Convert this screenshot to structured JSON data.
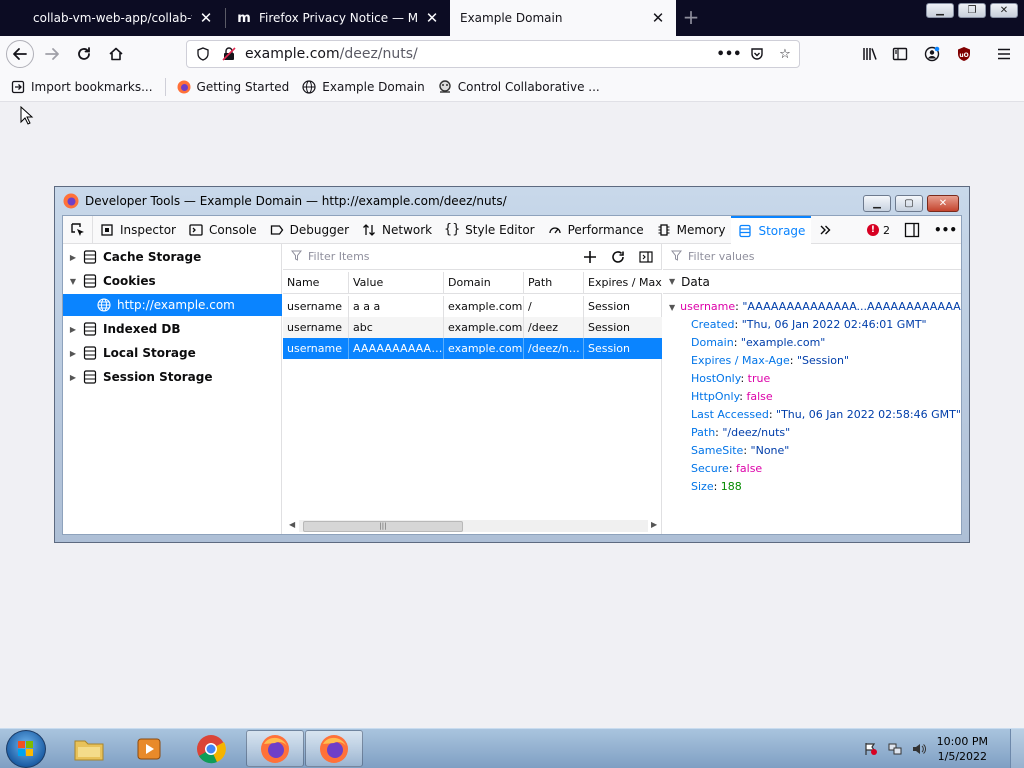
{
  "tabs": [
    {
      "title": "collab-vm-web-app/collab-vm",
      "favicon": "github-icon",
      "selected": false
    },
    {
      "title": "Firefox Privacy Notice — Mozilla",
      "favicon": "mozilla-icon",
      "selected": false
    },
    {
      "title": "Example Domain",
      "favicon": "",
      "selected": true
    }
  ],
  "tab_close_glyph": "✕",
  "newtab_glyph": "+",
  "urlbar": {
    "host": "example.com",
    "path": "/deez/nuts/"
  },
  "bookmarks": [
    {
      "label": "Import bookmarks...",
      "icon": "import-icon"
    },
    {
      "label": "Getting Started",
      "icon": "firefox-icon"
    },
    {
      "label": "Example Domain",
      "icon": "globe-icon"
    },
    {
      "label": "Control Collaborative ...",
      "icon": "collab-icon"
    }
  ],
  "devtools": {
    "title": "Developer Tools — Example Domain — http://example.com/deez/nuts/",
    "tools": [
      "Inspector",
      "Console",
      "Debugger",
      "Network",
      "Style Editor",
      "Performance",
      "Memory",
      "Storage"
    ],
    "selected_tool": "Storage",
    "error_count": "2",
    "tree": {
      "cache": "Cache Storage",
      "cookies": "Cookies",
      "cookie_host": "http://example.com",
      "indexeddb": "Indexed DB",
      "local": "Local Storage",
      "session": "Session Storage"
    },
    "filter_items_placeholder": "Filter Items",
    "filter_values_placeholder": "Filter values",
    "columns": [
      "Name",
      "Value",
      "Domain",
      "Path",
      "Expires / Max-Age"
    ],
    "rows": [
      [
        "username",
        "a a a",
        "example.com",
        "/",
        "Session"
      ],
      [
        "username",
        "abc",
        "example.com",
        "/deez",
        "Session"
      ],
      [
        "username",
        "AAAAAAAAAAAAAAAAAAAAAAAAAAAAAA",
        "example.com",
        "/deez/nuts",
        "Session"
      ]
    ],
    "selected_row": 2,
    "data_header": "Data",
    "data_root": {
      "key": "username",
      "value": "\"AAAAAAAAAAAAAA...AAAAAAAAAAAAAA\""
    },
    "data_props": [
      {
        "key": "Created",
        "value": "\"Thu, 06 Jan 2022 02:46:01 GMT\"",
        "kind": "str"
      },
      {
        "key": "Domain",
        "value": "\"example.com\"",
        "kind": "str"
      },
      {
        "key": "Expires / Max-Age",
        "value": "\"Session\"",
        "kind": "str"
      },
      {
        "key": "HostOnly",
        "value": "true",
        "kind": "bool"
      },
      {
        "key": "HttpOnly",
        "value": "false",
        "kind": "bool"
      },
      {
        "key": "Last Accessed",
        "value": "\"Thu, 06 Jan 2022 02:58:46 GMT\"",
        "kind": "str"
      },
      {
        "key": "Path",
        "value": "\"/deez/nuts\"",
        "kind": "str"
      },
      {
        "key": "SameSite",
        "value": "\"None\"",
        "kind": "str"
      },
      {
        "key": "Secure",
        "value": "false",
        "kind": "bool"
      },
      {
        "key": "Size",
        "value": "188",
        "kind": "num"
      }
    ]
  },
  "taskbar": {
    "time": "10:00 PM",
    "date": "1/5/2022"
  },
  "colors": {
    "accent": "#0a84ff",
    "tabstrip": "#0c0c23",
    "error": "#d70022"
  }
}
